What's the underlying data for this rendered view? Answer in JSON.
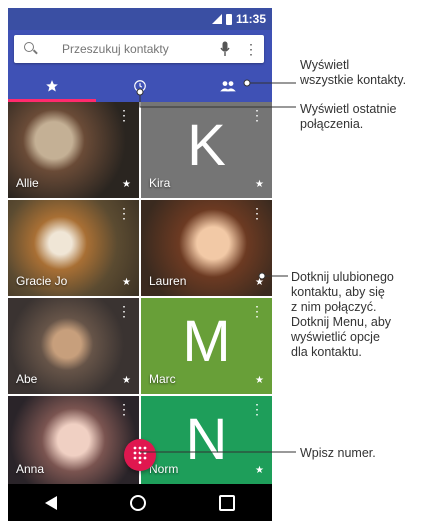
{
  "status_bar": {
    "time": "11:35"
  },
  "search": {
    "placeholder": "Przeszukuj kontakty"
  },
  "tabs": [
    {
      "icon": "star-icon",
      "active": true
    },
    {
      "icon": "clock-icon",
      "active": false
    },
    {
      "icon": "people-icon",
      "active": false
    }
  ],
  "contacts": [
    {
      "name": "Allie",
      "type": "photo"
    },
    {
      "name": "Kira",
      "type": "letter",
      "letter": "K",
      "color": "#757575"
    },
    {
      "name": "Gracie Jo",
      "type": "photo"
    },
    {
      "name": "Lauren",
      "type": "photo"
    },
    {
      "name": "Abe",
      "type": "photo"
    },
    {
      "name": "Marc",
      "type": "letter",
      "letter": "M",
      "color": "#689f38"
    },
    {
      "name": "Anna",
      "type": "photo"
    },
    {
      "name": "Norm",
      "type": "letter",
      "letter": "N",
      "color": "#1e9e5a"
    }
  ],
  "fab": {
    "icon": "dialpad-icon",
    "color": "#e0174f"
  },
  "callouts": {
    "all_contacts": "Wyświetl\nwszystkie kontakty.",
    "recent_calls": "Wyświetl ostatnie\npołączenia.",
    "favorite": "Dotknij ulubionego\nkontaktu, aby się\nz nim połączyć.\nDotknij Menu, aby\nwyświetlić opcje\ndla kontaktu.",
    "dial": "Wpisz numer."
  },
  "colors": {
    "app_bar": "#3f51b5",
    "status_bar": "#3a4fa3",
    "tab_indicator": "#ff2a6d"
  }
}
